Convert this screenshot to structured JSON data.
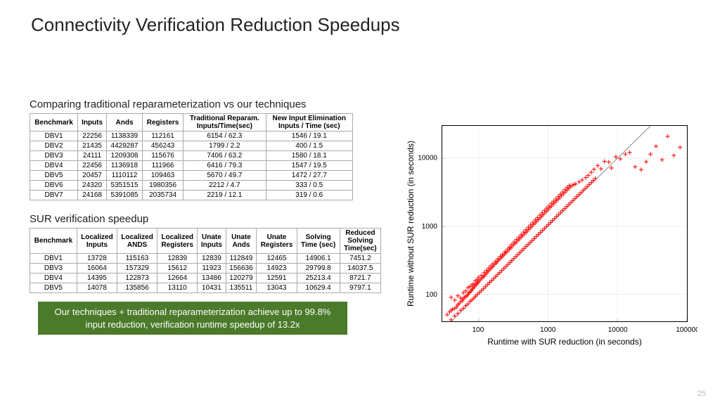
{
  "title": "Connectivity Verification Reduction Speedups",
  "page_number": "25",
  "sub1": "Comparing traditional reparameterization vs our techniques",
  "table1": {
    "headers": [
      "Benchmark",
      "Inputs",
      "Ands",
      "Registers",
      "Traditional Reparam.\nInputs/Time(sec)",
      "New Input Elimination\nInputs / Time (sec)"
    ],
    "rows": [
      [
        "DBV1",
        "22256",
        "1138339",
        "112161",
        "6154 / 62.3",
        "1546 / 19.1"
      ],
      [
        "DBV2",
        "21435",
        "4429287",
        "456243",
        "1799 / 2.2",
        "400 / 1.5"
      ],
      [
        "DBV3",
        "24111",
        "1209308",
        "115676",
        "7406 / 63.2",
        "1580 / 18.1"
      ],
      [
        "DBV4",
        "22456",
        "1136918",
        "111966",
        "6416 / 79.3",
        "1547 / 19.5"
      ],
      [
        "DBV5",
        "20457",
        "1110112",
        "109463",
        "5670 / 49.7",
        "1472 / 27.7"
      ],
      [
        "DBV6",
        "24320",
        "5351515",
        "1980356",
        "2212 / 4.7",
        "333 / 0.5"
      ],
      [
        "DBV7",
        "24168",
        "5391085",
        "2035734",
        "2219 / 12.1",
        "319 / 0.6"
      ]
    ]
  },
  "sub2": "SUR verification speedup",
  "table2": {
    "headers": [
      "Benchmark",
      "Localized\nInputs",
      "Localized\nANDS",
      "Localized\nRegisters",
      "Unate\nInputs",
      "Unate\nAnds",
      "Unate\nRegisters",
      "Solving\nTime (sec)",
      "Reduced\nSolving\nTime(sec)"
    ],
    "rows": [
      [
        "DBV1",
        "13728",
        "115163",
        "12839",
        "12839",
        "112849",
        "12465",
        "14906.1",
        "7451.2"
      ],
      [
        "DBV3",
        "16064",
        "157329",
        "15612",
        "11923",
        "156636",
        "14923",
        "29799.8",
        "14037.5"
      ],
      [
        "DBV4",
        "14395",
        "122873",
        "12664",
        "13486",
        "120279",
        "12591",
        "25213.4",
        "8721.7"
      ],
      [
        "DBV5",
        "14078",
        "135856",
        "13110",
        "10431",
        "135511",
        "13043",
        "10629.4",
        "9797.1"
      ]
    ]
  },
  "callout": "Our techniques + traditional reparameterization achieve up to 99.8% input reduction, verification runtime speedup of 13.2x",
  "chart_data": {
    "type": "scatter",
    "title": "",
    "xlabel": "Runtime with SUR reduction (in seconds)",
    "ylabel": "Runtime without SUR reduction (in seconds)",
    "xscale": "log",
    "yscale": "log",
    "xlim": [
      30,
      100000
    ],
    "ylim": [
      40,
      30000
    ],
    "xticks": [
      100,
      1000,
      10000,
      100000
    ],
    "yticks": [
      100,
      1000,
      10000
    ],
    "identity_line": true,
    "series": [
      {
        "name": "points",
        "marker": "+",
        "color": "#ff1a1a",
        "points": [
          [
            35,
            50
          ],
          [
            38,
            55
          ],
          [
            40,
            58
          ],
          [
            42,
            60
          ],
          [
            45,
            62
          ],
          [
            48,
            65
          ],
          [
            50,
            70
          ],
          [
            52,
            73
          ],
          [
            55,
            78
          ],
          [
            58,
            80
          ],
          [
            60,
            85
          ],
          [
            62,
            90
          ],
          [
            65,
            92
          ],
          [
            68,
            95
          ],
          [
            70,
            100
          ],
          [
            72,
            105
          ],
          [
            75,
            108
          ],
          [
            78,
            112
          ],
          [
            80,
            118
          ],
          [
            83,
            122
          ],
          [
            85,
            128
          ],
          [
            88,
            132
          ],
          [
            92,
            138
          ],
          [
            95,
            145
          ],
          [
            98,
            150
          ],
          [
            100,
            155
          ],
          [
            105,
            162
          ],
          [
            110,
            170
          ],
          [
            115,
            178
          ],
          [
            120,
            185
          ],
          [
            125,
            195
          ],
          [
            130,
            205
          ],
          [
            135,
            215
          ],
          [
            140,
            225
          ],
          [
            148,
            235
          ],
          [
            155,
            248
          ],
          [
            162,
            260
          ],
          [
            170,
            275
          ],
          [
            178,
            288
          ],
          [
            185,
            300
          ],
          [
            195,
            318
          ],
          [
            205,
            335
          ],
          [
            215,
            350
          ],
          [
            225,
            370
          ],
          [
            235,
            388
          ],
          [
            248,
            408
          ],
          [
            260,
            430
          ],
          [
            275,
            455
          ],
          [
            288,
            478
          ],
          [
            300,
            500
          ],
          [
            318,
            530
          ],
          [
            335,
            560
          ],
          [
            350,
            588
          ],
          [
            370,
            620
          ],
          [
            388,
            652
          ],
          [
            408,
            688
          ],
          [
            430,
            725
          ],
          [
            455,
            768
          ],
          [
            478,
            808
          ],
          [
            500,
            848
          ],
          [
            530,
            900
          ],
          [
            560,
            955
          ],
          [
            588,
            1005
          ],
          [
            620,
            1065
          ],
          [
            652,
            1120
          ],
          [
            688,
            1185
          ],
          [
            725,
            1252
          ],
          [
            768,
            1330
          ],
          [
            808,
            1400
          ],
          [
            848,
            1473
          ],
          [
            900,
            1570
          ],
          [
            955,
            1672
          ],
          [
            1005,
            1765
          ],
          [
            1065,
            1875
          ],
          [
            1120,
            1978
          ],
          [
            1185,
            2100
          ],
          [
            1252,
            2225
          ],
          [
            1330,
            2370
          ],
          [
            1400,
            2500
          ],
          [
            1473,
            2635
          ],
          [
            1570,
            2815
          ],
          [
            1672,
            3005
          ],
          [
            1765,
            3178
          ],
          [
            1875,
            3382
          ],
          [
            1978,
            3575
          ],
          [
            2100,
            3800
          ],
          [
            2225,
            4000
          ],
          [
            2370,
            4100
          ],
          [
            2500,
            4200
          ],
          [
            2800,
            4500
          ],
          [
            3100,
            4800
          ],
          [
            3500,
            5200
          ],
          [
            3800,
            5600
          ],
          [
            4200,
            6200
          ],
          [
            4600,
            6900
          ],
          [
            5200,
            7800
          ],
          [
            5800,
            7000
          ],
          [
            6500,
            9000
          ],
          [
            7500,
            8800
          ],
          [
            8200,
            7200
          ],
          [
            9500,
            10500
          ],
          [
            11000,
            9800
          ],
          [
            13000,
            11500
          ],
          [
            15000,
            12200
          ],
          [
            18000,
            7500
          ],
          [
            22000,
            6800
          ],
          [
            26000,
            8900
          ],
          [
            30000,
            11500
          ],
          [
            36000,
            15000
          ],
          [
            44000,
            9500
          ],
          [
            53000,
            21000
          ],
          [
            65000,
            11000
          ],
          [
            80000,
            14500
          ],
          [
            40,
            90
          ],
          [
            45,
            82
          ],
          [
            50,
            95
          ],
          [
            55,
            88
          ],
          [
            60,
            105
          ],
          [
            65,
            112
          ],
          [
            70,
            125
          ],
          [
            75,
            130
          ],
          [
            80,
            138
          ],
          [
            85,
            142
          ],
          [
            90,
            158
          ],
          [
            95,
            165
          ],
          [
            100,
            178
          ],
          [
            110,
            190
          ],
          [
            120,
            208
          ],
          [
            130,
            225
          ],
          [
            140,
            242
          ],
          [
            150,
            262
          ],
          [
            160,
            280
          ],
          [
            175,
            305
          ],
          [
            190,
            332
          ],
          [
            205,
            360
          ],
          [
            220,
            388
          ],
          [
            240,
            422
          ],
          [
            260,
            460
          ],
          [
            280,
            498
          ],
          [
            300,
            540
          ],
          [
            325,
            588
          ],
          [
            350,
            638
          ],
          [
            380,
            695
          ],
          [
            410,
            752
          ],
          [
            445,
            820
          ],
          [
            480,
            890
          ],
          [
            520,
            968
          ],
          [
            560,
            1050
          ],
          [
            605,
            1140
          ],
          [
            655,
            1238
          ],
          [
            705,
            1340
          ],
          [
            765,
            1458
          ],
          [
            825,
            1578
          ],
          [
            890,
            1710
          ],
          [
            960,
            1850
          ],
          [
            1035,
            2000
          ],
          [
            1118,
            2165
          ],
          [
            1205,
            2340
          ],
          [
            1300,
            2530
          ],
          [
            1400,
            2735
          ],
          [
            1510,
            2960
          ],
          [
            1628,
            3200
          ],
          [
            1755,
            3460
          ],
          [
            1892,
            3740
          ],
          [
            2040,
            4000
          ],
          [
            40,
            42
          ],
          [
            45,
            48
          ],
          [
            50,
            52
          ],
          [
            55,
            58
          ],
          [
            60,
            62
          ],
          [
            65,
            68
          ],
          [
            70,
            72
          ],
          [
            75,
            79
          ],
          [
            80,
            83
          ],
          [
            85,
            88
          ],
          [
            90,
            94
          ],
          [
            96,
            100
          ],
          [
            103,
            107
          ],
          [
            110,
            114
          ],
          [
            118,
            122
          ],
          [
            126,
            131
          ],
          [
            135,
            140
          ],
          [
            144,
            150
          ],
          [
            154,
            160
          ],
          [
            165,
            171
          ],
          [
            176,
            183
          ],
          [
            188,
            196
          ],
          [
            201,
            209
          ],
          [
            215,
            224
          ],
          [
            230,
            240
          ],
          [
            246,
            256
          ],
          [
            263,
            274
          ],
          [
            281,
            293
          ],
          [
            300,
            314
          ],
          [
            321,
            336
          ],
          [
            343,
            360
          ],
          [
            367,
            385
          ],
          [
            392,
            412
          ],
          [
            420,
            441
          ],
          [
            449,
            472
          ],
          [
            480,
            505
          ],
          [
            514,
            540
          ],
          [
            550,
            578
          ],
          [
            589,
            619
          ],
          [
            630,
            662
          ],
          [
            674,
            709
          ],
          [
            721,
            758
          ],
          [
            772,
            811
          ],
          [
            826,
            868
          ],
          [
            884,
            929
          ],
          [
            946,
            994
          ],
          [
            1012,
            1064
          ],
          [
            1083,
            1138
          ],
          [
            1158,
            1218
          ],
          [
            1240,
            1303
          ],
          [
            1327,
            1395
          ],
          [
            1419,
            1493
          ],
          [
            1518,
            1597
          ],
          [
            1625,
            1709
          ],
          [
            1738,
            1828
          ],
          [
            1860,
            1956
          ],
          [
            1990,
            2093
          ],
          [
            2129,
            2239
          ],
          [
            2278,
            2396
          ],
          [
            2438,
            2564
          ],
          [
            2608,
            2743
          ],
          [
            2791,
            2935
          ],
          [
            2986,
            3141
          ],
          [
            3195,
            3360
          ],
          [
            3419,
            3596
          ],
          [
            3658,
            3847
          ],
          [
            3914,
            4117
          ],
          [
            4188,
            4405
          ],
          [
            4481,
            4713
          ],
          [
            4795,
            5043
          ]
        ]
      }
    ]
  }
}
